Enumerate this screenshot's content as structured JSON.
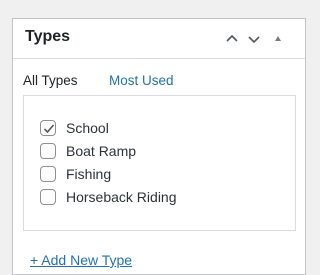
{
  "panel": {
    "title": "Types",
    "buttons": {
      "move_up": "chevron-up-icon",
      "move_down": "chevron-down-icon",
      "toggle": "triangle-up-icon"
    }
  },
  "tabs": [
    {
      "label": "All Types",
      "active": true
    },
    {
      "label": "Most Used",
      "active": false
    }
  ],
  "types": [
    {
      "label": "School",
      "checked": true
    },
    {
      "label": "Boat Ramp",
      "checked": false
    },
    {
      "label": "Fishing",
      "checked": false
    },
    {
      "label": "Horseback Riding",
      "checked": false
    }
  ],
  "add_link": "+ Add New Type",
  "colors": {
    "link": "#2271b1",
    "text": "#1d2327",
    "border": "#c3c4c7"
  }
}
